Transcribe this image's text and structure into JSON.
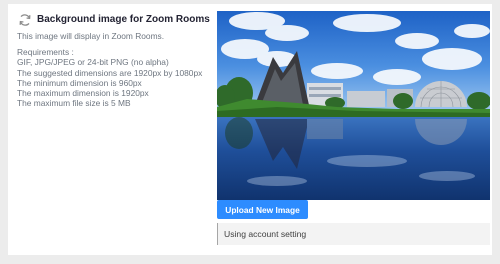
{
  "section": {
    "title": "Background image for Zoom Rooms",
    "description": "This image will display in Zoom Rooms.",
    "icon": "refresh-icon"
  },
  "requirements": {
    "heading": "Requirements :",
    "lines": [
      "GIF, JPG/JPEG or 24-bit PNG (no alpha)",
      "The suggested dimensions are 1920px by 1080px",
      "The minimum dimension is 960px",
      "The maximum dimension is 1920px",
      "The maximum file size is 5 MB"
    ]
  },
  "preview": {
    "subject": "park-lake-with-dome-photo"
  },
  "actions": {
    "upload_label": "Upload New Image",
    "status_text": "Using account setting"
  },
  "colors": {
    "accent": "#2d8cff",
    "title": "#232333",
    "muted_text": "#6e7680"
  }
}
